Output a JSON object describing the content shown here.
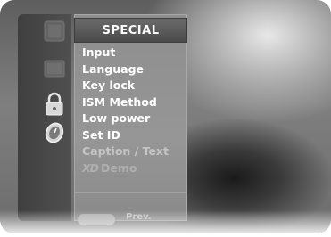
{
  "menu": {
    "title": "SPECIAL",
    "items": [
      {
        "label": "Input"
      },
      {
        "label": "Language"
      },
      {
        "label": "Key lock"
      },
      {
        "label": "ISM Method"
      },
      {
        "label": "Low power"
      },
      {
        "label": "Set ID"
      },
      {
        "label": "Caption / Text"
      },
      {
        "label": "Demo",
        "logo": "XD"
      }
    ]
  },
  "footer": {
    "prev_label": "Prev."
  },
  "sidebar": {
    "icons": [
      "picture-icon",
      "screen-icon",
      "lock-icon",
      "clock-icon"
    ]
  }
}
